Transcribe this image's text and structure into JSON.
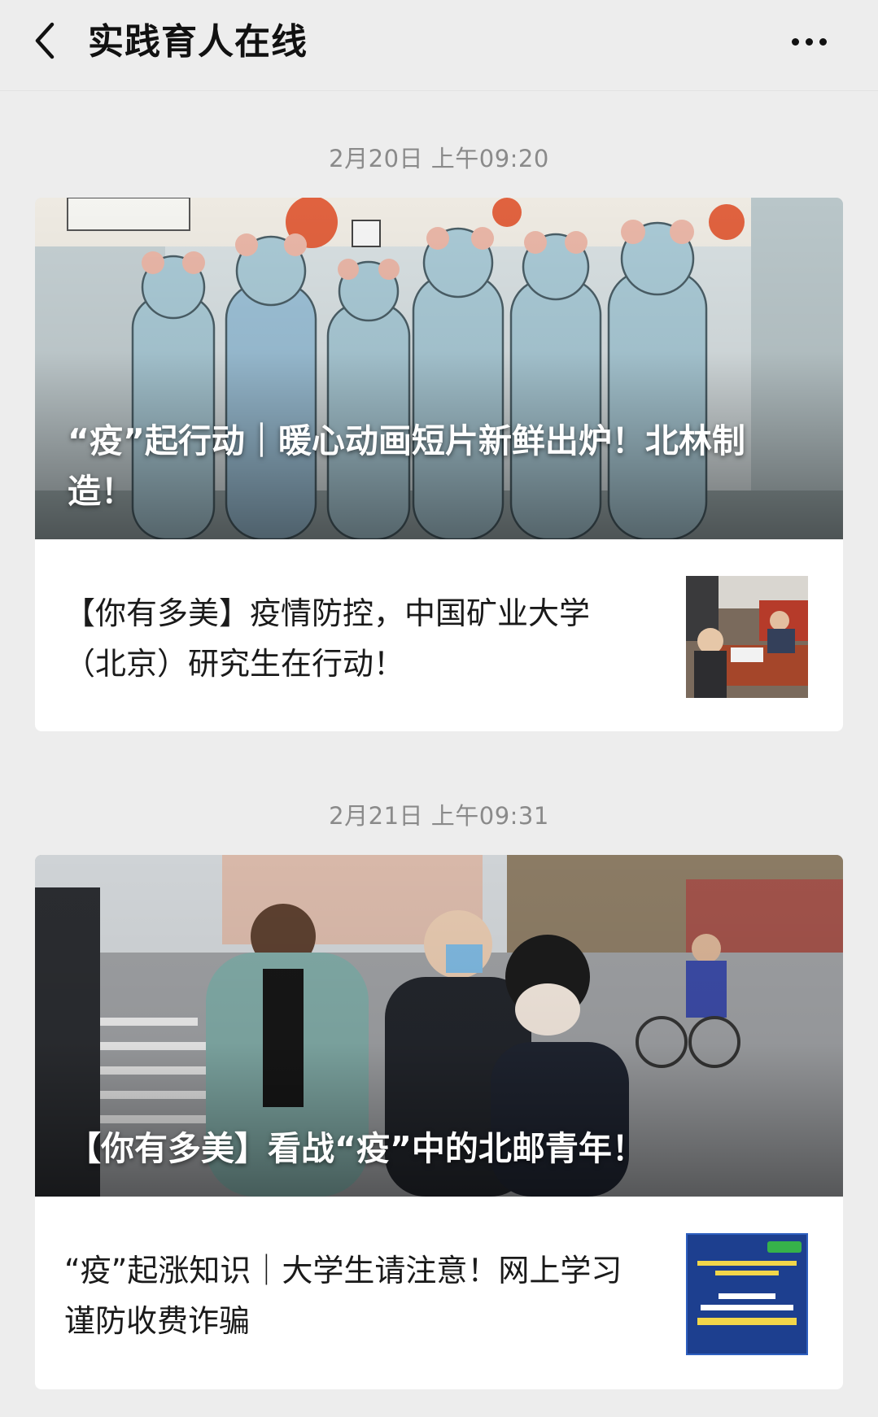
{
  "header": {
    "back_icon": "chevron-left-icon",
    "title": "实践育人在线",
    "more_icon": "more-dots-icon"
  },
  "messages": [
    {
      "timestamp": "2月20日 上午09:20",
      "main_article": {
        "title": "“疫”起行动｜暖心动画短片新鲜出炉！北林制造！",
        "image": "illustration-medical-workers-in-protective-suits"
      },
      "sub_article": {
        "title": "【你有多美】疫情防控，中国矿业大学（北京）研究生在行动！",
        "thumbnail": "photo-volunteers-at-desk"
      }
    },
    {
      "timestamp": "2月21日 上午09:31",
      "main_article": {
        "title": "【你有多美】看战“疫”中的北邮青年！",
        "image": "photo-temperature-check-on-street"
      },
      "sub_article": {
        "title": "“疫”起涨知识｜大学生请注意！网上学习谨防收费诈骗",
        "thumbnail": "notice-poster-blue"
      }
    }
  ],
  "colors": {
    "background": "#ededed",
    "card": "#ffffff",
    "timestamp": "#8a8a8a",
    "text": "#1a1a1a",
    "poster_blue": "#1d3f8f"
  }
}
